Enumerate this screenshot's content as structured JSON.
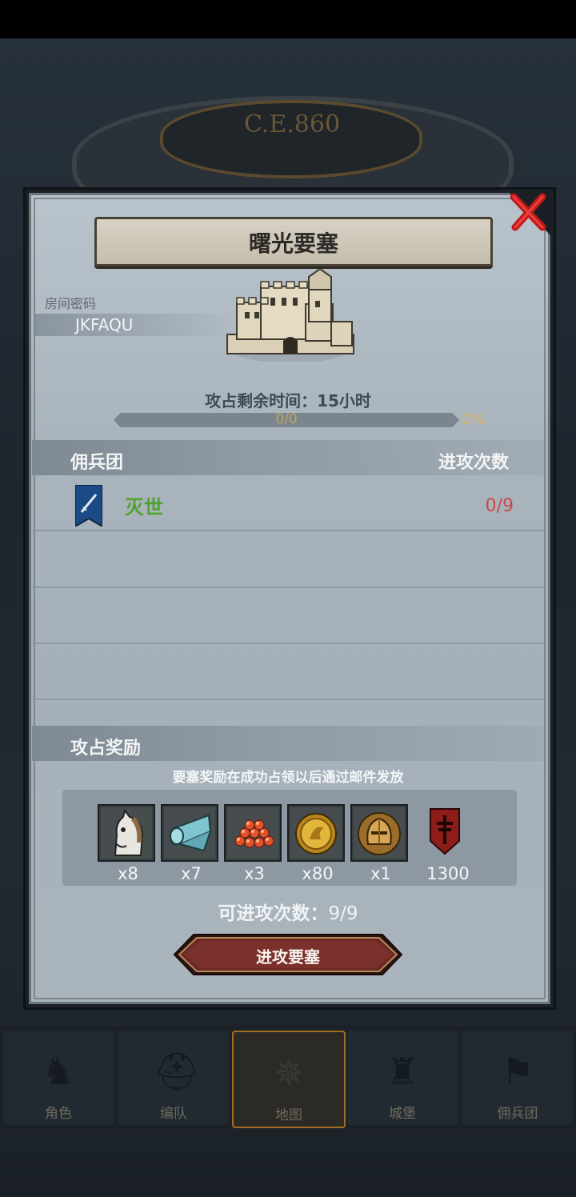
{
  "era": "C.E.860",
  "dialog": {
    "title": "曙光要塞",
    "room_label": "房间密码",
    "room_code": "JKFAQU",
    "time_remaining": "攻占剩余时间：15小时",
    "progress": {
      "text": "0/0",
      "percent_text": "0%",
      "fill": 0
    }
  },
  "guild_section": {
    "title": "佣兵团",
    "attacks_header": "进攻次数",
    "rows": [
      {
        "name": "灭世",
        "count": "0/9"
      }
    ]
  },
  "reward_section": {
    "title": "攻占奖励",
    "note": "要塞奖励在成功占领以后通过邮件发放",
    "items": [
      {
        "icon": "horse-icon",
        "qty": "x8"
      },
      {
        "icon": "cloth-roll-icon",
        "qty": "x7"
      },
      {
        "icon": "red-gems-icon",
        "qty": "x3"
      },
      {
        "icon": "gold-coin-icon",
        "qty": "x80"
      },
      {
        "icon": "knight-helmet-icon",
        "qty": "x1"
      },
      {
        "icon": "red-banner-icon",
        "qty": "1300"
      }
    ]
  },
  "attempts": {
    "label": "可进攻次数：",
    "value": "9/9"
  },
  "attack_button": "进攻要塞",
  "bottom_nav": [
    {
      "label": "角色",
      "icon": "knight-icon",
      "active": false
    },
    {
      "label": "编队",
      "icon": "helmet-icon",
      "active": false
    },
    {
      "label": "地图",
      "icon": "compass-icon",
      "active": true
    },
    {
      "label": "城堡",
      "icon": "castle-icon",
      "active": false
    },
    {
      "label": "佣兵团",
      "icon": "mercenary-icon",
      "active": false
    }
  ],
  "colors": {
    "guild_name": "#4fa32e",
    "attack_count": "#c84a48",
    "button": "#6b2a26",
    "active_nav_border": "#a06d22"
  }
}
